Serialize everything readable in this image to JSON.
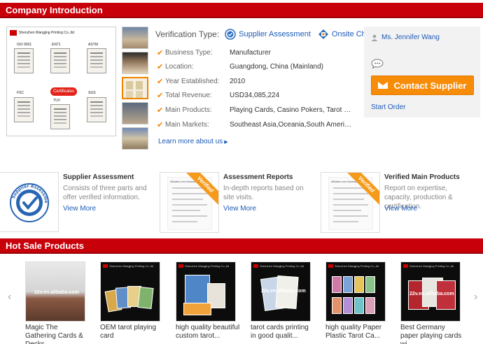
{
  "company_section": {
    "title": "Company Introduction",
    "cert_header": "Shenzhen Wangjing Printing Co.,ltd.",
    "cert_labels": [
      "ISO 9001",
      "EN71",
      "ASTM",
      "FSC",
      "SGS",
      "TUV"
    ],
    "cert_badge": "Certificates",
    "verification_label": "Verification Type:",
    "verification_links": [
      "Supplier Assessment",
      "Onsite Check"
    ],
    "details": [
      {
        "key": "Business Type:",
        "value": "Manufacturer"
      },
      {
        "key": "Location:",
        "value": "Guangdong, China (Mainland)"
      },
      {
        "key": "Year Established:",
        "value": "2010"
      },
      {
        "key": "Total Revenue:",
        "value": "USD34,085,224"
      },
      {
        "key": "Main Products:",
        "value": "Playing Cards, Casino Pokers, Tarot Card..."
      },
      {
        "key": "Main Markets:",
        "value": "Southeast Asia,Oceania,South America,C..."
      }
    ],
    "learn_more": "Learn more about us"
  },
  "contact": {
    "person": "Ms. Jennifer Wang",
    "button_label": "Contact Supplier",
    "start_order": "Start Order"
  },
  "assessment": {
    "items": [
      {
        "title": "Supplier Assessment",
        "desc": "Consists of three parts and offer verified information.",
        "more": "View More"
      },
      {
        "title": "Assessment Reports",
        "desc": "In-depth reports based on site visits.",
        "more": "View More"
      },
      {
        "title": "Verified Main Products",
        "desc": "Report on expertise, capacity, production & certification.",
        "more": "View More"
      }
    ],
    "ribbon": "Verified",
    "seal_text": "Supplier Assessment",
    "report_header": "Alibaba.com Assessment"
  },
  "hot_sale": {
    "title": "Hot Sale Products",
    "image_header": "Shenzhen Wangjing Printing Co.,ltd",
    "watermark": "22v.en.alibaba.com",
    "products": [
      {
        "name": "Magic The Gathering Cards & Decks"
      },
      {
        "name": "OEM tarot playing card"
      },
      {
        "name": "high quality beautiful custom tarot..."
      },
      {
        "name": "tarot cards printing in good qualit..."
      },
      {
        "name": "high quality Paper Plastic Tarot Ca..."
      },
      {
        "name": "Best Germany paper playing cards wi..."
      }
    ],
    "prev": "‹",
    "next": "›"
  },
  "colors": {
    "brand_red": "#c8000a",
    "accent_orange": "#f78c08",
    "link_blue": "#1e5bb8"
  }
}
